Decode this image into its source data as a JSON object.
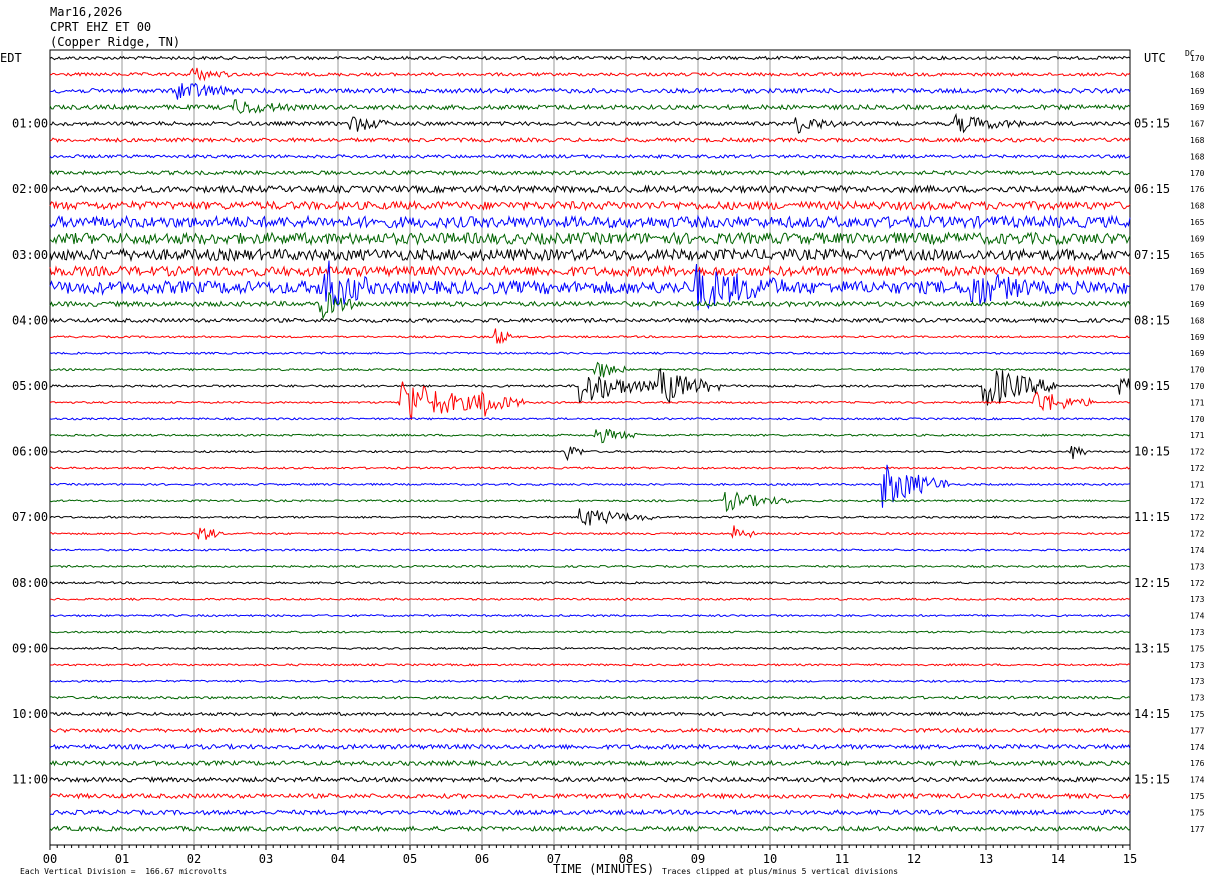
{
  "header": {
    "date": "Mar16,2026",
    "station": "CPRT EHZ ET 00",
    "location": "(Copper Ridge, TN)"
  },
  "left_axis_title": "EDT",
  "right_axis_title": "UTC",
  "dc_title": "DC",
  "footer": {
    "division_note": "Each Vertical Division =  166.67 microvolts",
    "xlabel": "TIME (MINUTES)",
    "clip_note": "Traces clipped at plus/minus 5 vertical divisions"
  },
  "colors": {
    "black": "#000000",
    "red": "#ff0000",
    "blue": "#0000ff",
    "green": "#006400",
    "grid": "#999999"
  },
  "chart_data": {
    "type": "line",
    "title": "CPRT EHZ ET 00",
    "xlabel": "TIME (MINUTES)",
    "x_ticks": [
      "00",
      "01",
      "02",
      "03",
      "04",
      "05",
      "06",
      "07",
      "08",
      "09",
      "10",
      "11",
      "12",
      "13",
      "14",
      "15"
    ],
    "xlim": [
      0,
      15
    ],
    "trace_color_cycle": [
      "black",
      "red",
      "blue",
      "green"
    ],
    "edt_labels": [
      "01:00",
      "02:00",
      "03:00",
      "04:00",
      "05:00",
      "06:00",
      "07:00",
      "08:00",
      "09:00",
      "10:00",
      "11:00"
    ],
    "utc_labels": [
      "05:15",
      "06:15",
      "07:15",
      "08:15",
      "09:15",
      "10:15",
      "11:15",
      "12:15",
      "13:15",
      "14:15",
      "15:15"
    ],
    "dc_offsets": [
      170,
      168,
      169,
      169,
      167,
      168,
      168,
      170,
      176,
      168,
      165,
      169,
      165,
      169,
      170,
      169,
      168,
      169,
      169,
      170,
      170,
      171,
      170,
      171,
      172,
      172,
      171,
      172,
      172,
      172,
      174,
      173,
      172,
      173,
      174,
      173,
      175,
      173,
      173,
      173,
      175,
      177,
      174,
      176,
      174,
      175,
      175,
      177
    ],
    "noise_level": [
      1.0,
      1.0,
      1.4,
      1.4,
      1.2,
      1.2,
      1.0,
      1.2,
      2.0,
      2.5,
      3.5,
      3.5,
      3.5,
      3.0,
      4.0,
      1.5,
      1.2,
      0.6,
      0.6,
      0.6,
      0.7,
      0.6,
      0.6,
      0.6,
      0.6,
      0.6,
      0.6,
      0.6,
      0.6,
      0.6,
      0.6,
      0.6,
      0.6,
      0.6,
      0.6,
      0.6,
      0.6,
      0.6,
      0.6,
      0.8,
      1.0,
      1.2,
      1.4,
      1.4,
      1.4,
      1.4,
      1.4,
      1.4
    ],
    "events": [
      {
        "trace": 1,
        "minute": 2.0,
        "amp": 2.0,
        "dur": 0.5
      },
      {
        "trace": 2,
        "minute": 1.8,
        "amp": 3.0,
        "dur": 0.8
      },
      {
        "trace": 3,
        "minute": 2.6,
        "amp": 2.0,
        "dur": 0.8
      },
      {
        "trace": 4,
        "minute": 4.2,
        "amp": 2.5,
        "dur": 0.5
      },
      {
        "trace": 4,
        "minute": 10.4,
        "amp": 2.5,
        "dur": 0.5
      },
      {
        "trace": 4,
        "minute": 12.6,
        "amp": 2.5,
        "dur": 0.9
      },
      {
        "trace": 14,
        "minute": 3.8,
        "amp": 8.0,
        "dur": 0.6
      },
      {
        "trace": 14,
        "minute": 9.0,
        "amp": 6.0,
        "dur": 1.2
      },
      {
        "trace": 14,
        "minute": 12.8,
        "amp": 5.0,
        "dur": 0.8
      },
      {
        "trace": 15,
        "minute": 3.8,
        "amp": 4.0,
        "dur": 0.4
      },
      {
        "trace": 17,
        "minute": 6.2,
        "amp": 3.0,
        "dur": 0.2
      },
      {
        "trace": 19,
        "minute": 7.6,
        "amp": 3.0,
        "dur": 0.4
      },
      {
        "trace": 20,
        "minute": 7.4,
        "amp": 6.0,
        "dur": 1.0
      },
      {
        "trace": 20,
        "minute": 8.5,
        "amp": 6.0,
        "dur": 0.8
      },
      {
        "trace": 20,
        "minute": 13.0,
        "amp": 7.0,
        "dur": 1.0
      },
      {
        "trace": 20,
        "minute": 14.9,
        "amp": 3.0,
        "dur": 0.3
      },
      {
        "trace": 21,
        "minute": 4.9,
        "amp": 8.0,
        "dur": 1.2
      },
      {
        "trace": 21,
        "minute": 6.0,
        "amp": 4.0,
        "dur": 0.6
      },
      {
        "trace": 21,
        "minute": 13.7,
        "amp": 4.0,
        "dur": 0.8
      },
      {
        "trace": 23,
        "minute": 7.6,
        "amp": 2.5,
        "dur": 0.6
      },
      {
        "trace": 24,
        "minute": 7.2,
        "amp": 2.5,
        "dur": 0.2
      },
      {
        "trace": 24,
        "minute": 14.2,
        "amp": 2.5,
        "dur": 0.2
      },
      {
        "trace": 26,
        "minute": 11.6,
        "amp": 7.0,
        "dur": 0.9
      },
      {
        "trace": 27,
        "minute": 9.4,
        "amp": 3.0,
        "dur": 0.9
      },
      {
        "trace": 28,
        "minute": 7.4,
        "amp": 3.0,
        "dur": 1.0
      },
      {
        "trace": 29,
        "minute": 2.1,
        "amp": 2.5,
        "dur": 0.3
      },
      {
        "trace": 29,
        "minute": 9.5,
        "amp": 2.5,
        "dur": 0.3
      }
    ]
  }
}
